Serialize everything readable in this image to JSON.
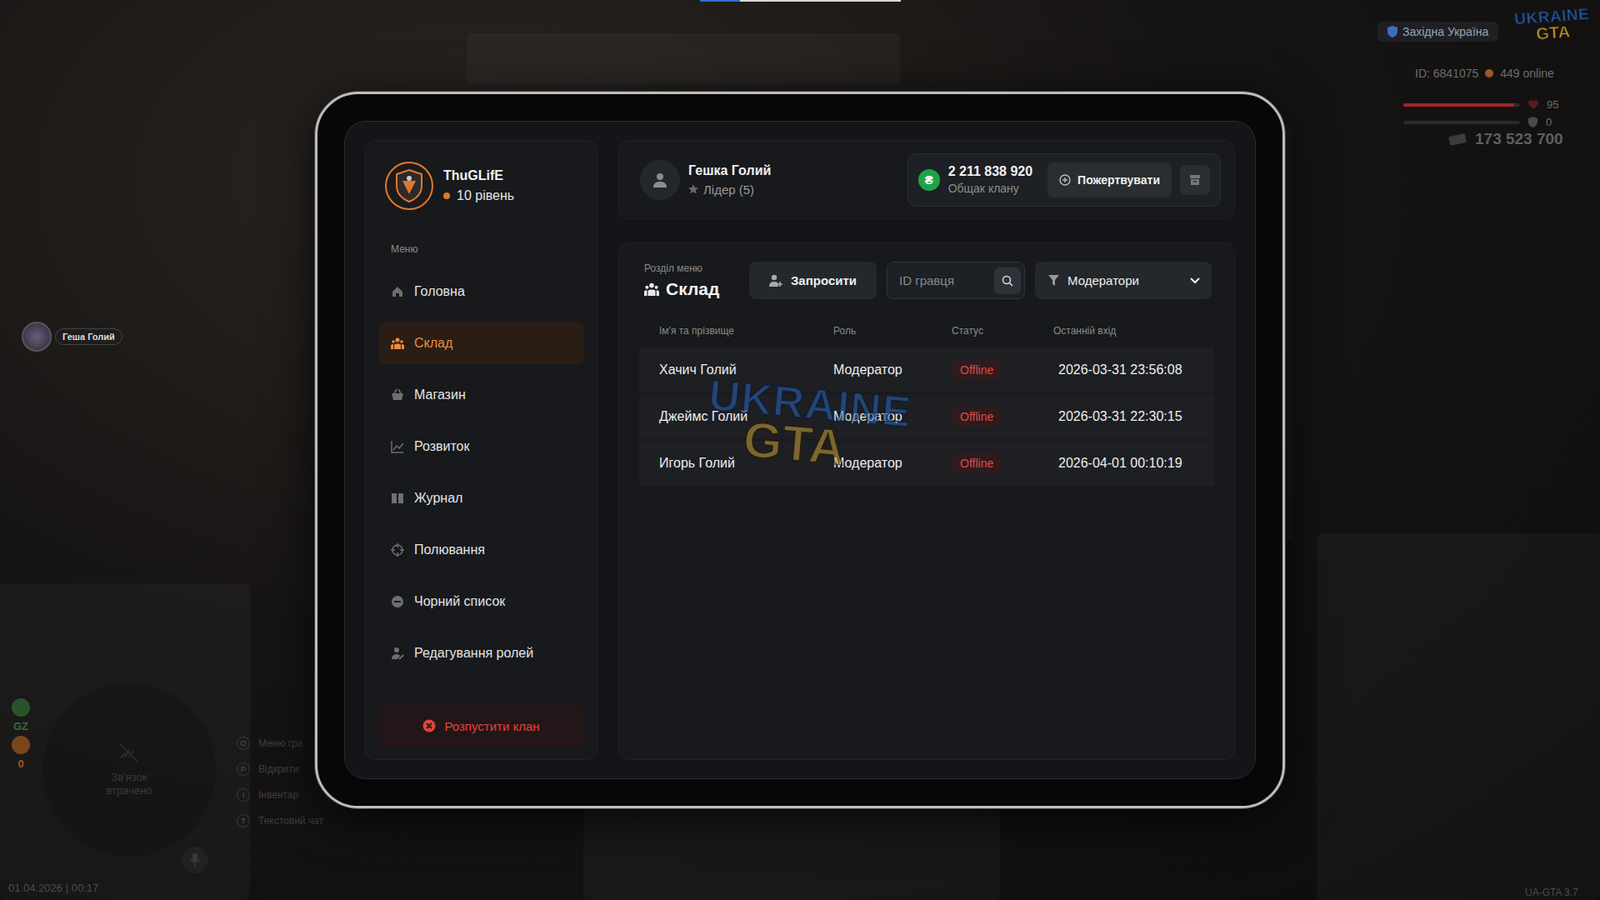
{
  "hud": {
    "region": "Західна Україна",
    "logo": {
      "line1": "UKRAINE",
      "line2": "GTA"
    },
    "id": "ID: 6841075",
    "online": "449 online",
    "health": {
      "reading": "95",
      "level": 0.95
    },
    "armor": {
      "reading": "0",
      "level": 0
    },
    "money": "173 523 700",
    "player_tag": "Геша Голий",
    "minimap_status": "Зв'язок втрачено",
    "zone": "GZ",
    "wanted": "0",
    "hotkeys": [
      {
        "key": "O",
        "label": "Меню гра"
      },
      {
        "key": "P",
        "label": "Відкрити"
      },
      {
        "key": "I",
        "label": "Інвентар"
      },
      {
        "key": "T",
        "label": "Текстовий чат"
      }
    ],
    "datetime": "01.04.2026 | 00:17",
    "version": "UA-GTA 3.7"
  },
  "clan": {
    "name": "ThuGLifE",
    "level": "10 рівень"
  },
  "menu": {
    "title": "Меню",
    "items": [
      {
        "label": "Головна",
        "selected": false
      },
      {
        "label": "Склад",
        "selected": true
      },
      {
        "label": "Магазин",
        "selected": false
      },
      {
        "label": "Розвиток",
        "selected": false
      },
      {
        "label": "Журнал",
        "selected": false
      },
      {
        "label": "Полювання",
        "selected": false
      },
      {
        "label": "Чорний список",
        "selected": false
      },
      {
        "label": "Редагування ролей",
        "selected": false
      }
    ]
  },
  "disband": "Розпустити клан",
  "user": {
    "name": "Гешка Голий",
    "role": "Лідер (5)"
  },
  "treasury": {
    "currency": "₴",
    "amount": "2 211 838 920",
    "label": "Общак клану"
  },
  "donate": "Пожертвувати",
  "section": {
    "caption": "Розділ меню",
    "title": "Склад"
  },
  "invite": "Запросити",
  "search": {
    "placeholder": "ID гравця"
  },
  "filter": {
    "value": "Модератори"
  },
  "table": {
    "columns": [
      "Ім'я та прізвище",
      "Роль",
      "Статус",
      "Останній вхід"
    ],
    "rows": [
      {
        "name": "Хачич Голий",
        "role": "Модератор",
        "status": "Offline",
        "online": false,
        "last": "2026-03-31 23:56:08"
      },
      {
        "name": "Джеймс Голий",
        "role": "Модератор",
        "status": "Offline",
        "online": false,
        "last": "2026-03-31 22:30:15"
      },
      {
        "name": "Игорь Голий",
        "role": "Модератор",
        "status": "Offline",
        "online": false,
        "last": "2026-04-01 00:10:19"
      }
    ]
  },
  "watermark": {
    "line1": "UKRAINE",
    "line2": "GTA"
  }
}
